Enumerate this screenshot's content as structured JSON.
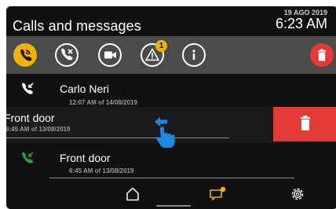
{
  "header": {
    "title": "Calls and messages",
    "date": "19 AGO 2019",
    "time": "6:23 AM"
  },
  "toolbar": {
    "items": [
      {
        "icon": "phone-calls-icon",
        "active": true
      },
      {
        "icon": "missed-call-icon"
      },
      {
        "icon": "video-icon"
      },
      {
        "icon": "alert-icon",
        "badge": "1"
      },
      {
        "icon": "info-icon"
      },
      {
        "icon": "trash-icon"
      }
    ]
  },
  "calls": [
    {
      "name": "Carlo Neri",
      "when": "12:07 AM of 14/08/2019",
      "icon": "incoming-call-icon",
      "icon_color": "#ffffff"
    },
    {
      "name": "Front door",
      "when": "6:45 AM of 13/08/2019",
      "icon": "incoming-call-icon",
      "icon_color": "#ffffff",
      "swiped": true
    },
    {
      "name": "Front door",
      "when": "6:45 AM of 13/08/2019",
      "icon": "incoming-call-icon",
      "icon_color": "#2e9d3a"
    }
  ],
  "gesture": {
    "icon": "swipe-left-hand-icon",
    "color": "#1e88e5"
  },
  "navbar": {
    "items": [
      {
        "icon": "home-icon"
      },
      {
        "icon": "messages-icon",
        "active": true,
        "accent": "#f0b400"
      },
      {
        "icon": "settings-gear-icon"
      }
    ]
  },
  "colors": {
    "accent": "#f0b400",
    "danger": "#e53935",
    "background": "#111111",
    "toolbar": "#4b4b4b"
  }
}
